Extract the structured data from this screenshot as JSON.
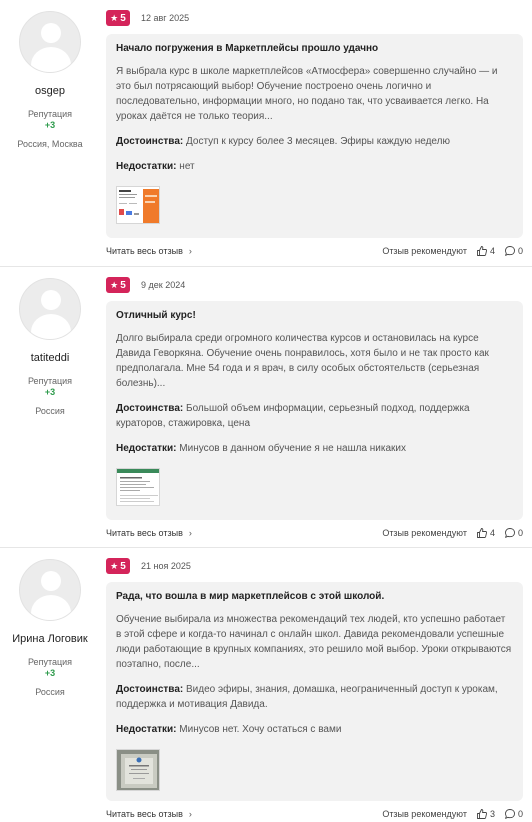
{
  "labels": {
    "reputation": "Репутация",
    "advantages": "Достоинства:",
    "disadvantages": "Недостатки:",
    "read_full": "Читать весь отзыв",
    "recommended": "Отзыв рекомендуют"
  },
  "reviews": [
    {
      "username": "osgep",
      "reputation": "+3",
      "location": "Россия, Москва",
      "rating": "5",
      "date": "12 авг 2025",
      "title": "Начало погружения в Маркетплейсы прошло удачно",
      "text": "Я выбрала курс в школе маркетплейсов «Атмосфера» совершенно случайно — и это был потрясающий выбор! Обучение построено очень логично и последовательно, информации много, но подано так, что усваивается легко. На уроках даётся не только теория...",
      "advantages": "Доступ к курсу более 3 месяцев. Эфиры каждую неделю",
      "disadvantages": "нет",
      "likes": "4",
      "comments": "0"
    },
    {
      "username": "tatiteddi",
      "reputation": "+3",
      "location": "Россия",
      "rating": "5",
      "date": "9 дек 2024",
      "title": "Отличный курс!",
      "text": "Долго выбирала среди огромного количества курсов и остановилась на курсе Давида Геворкяна. Обучение очень понравилось, хотя было и не так просто как предполагала. Мне 54 года и я врач, в силу особых обстоятельств (серьезная болезнь)...",
      "advantages": "Большой объем информации, серьезный подход, поддержка кураторов, стажировка, цена",
      "disadvantages": "Минусов в данном обучение я не нашла никаких",
      "likes": "4",
      "comments": "0"
    },
    {
      "username": "Ирина Логовик",
      "reputation": "+3",
      "location": "Россия",
      "rating": "5",
      "date": "21 ноя 2025",
      "title": "Рада, что вошла в мир маркетплейсов с этой школой.",
      "text": "Обучение выбирала из множества рекомендаций тех людей, кто успешно работает в этой сфере и когда-то начинал с онлайн школ. Давида рекомендовали успешные люди работающие в крупных компаниях, это решило мой выбор. Уроки открываются поэтапно, после...",
      "advantages": "Видео эфиры, знания, домашка, неограниченный доступ к урокам, поддержка и мотивация Давида.",
      "disadvantages": "Минусов нет. Хочу остаться с вами",
      "likes": "3",
      "comments": "0"
    }
  ]
}
